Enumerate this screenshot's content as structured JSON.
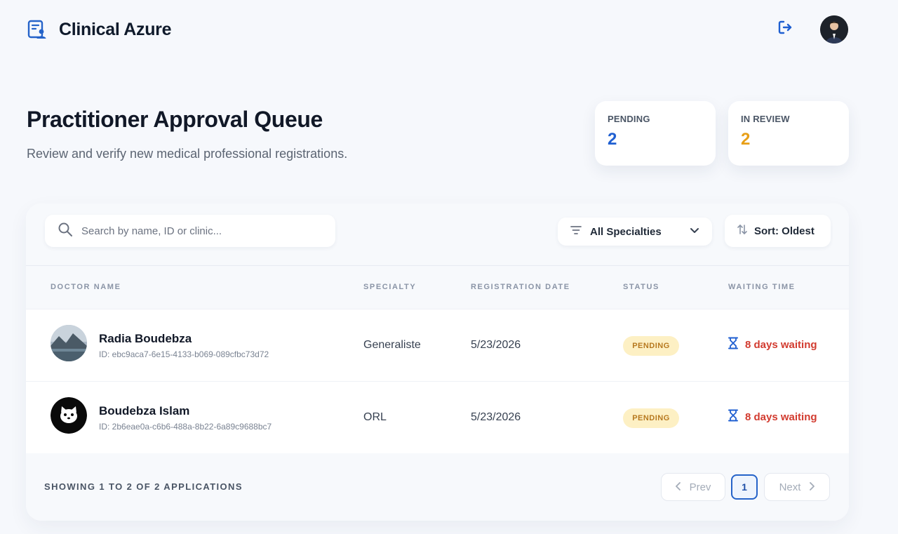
{
  "header": {
    "app_name": "Clinical Azure",
    "brand_icon": "clipboard-user-icon",
    "logout_icon": "logout-icon",
    "avatar": "user-avatar"
  },
  "page": {
    "title": "Practitioner Approval Queue",
    "subtitle": "Review and verify new medical professional registrations."
  },
  "stats": [
    {
      "label": "PENDING",
      "value": "2",
      "color": "#1f5fd1"
    },
    {
      "label": "IN REVIEW",
      "value": "2",
      "color": "#e89f17"
    }
  ],
  "toolbar": {
    "search_placeholder": "Search by name, ID or clinic...",
    "search_value": "",
    "filter_label": "All Specialties",
    "sort_label": "Sort: Oldest"
  },
  "table": {
    "columns": [
      "DOCTOR NAME",
      "SPECIALTY",
      "REGISTRATION DATE",
      "STATUS",
      "WAITING TIME"
    ],
    "rows": [
      {
        "name": "Radia Boudebza",
        "id": "ID: ebc9aca7-6e15-4133-b069-089cfbc73d72",
        "specialty": "Generaliste",
        "date": "5/23/2026",
        "status": "PENDING",
        "waiting": "8 days waiting",
        "avatar": "landscape-avatar"
      },
      {
        "name": "Boudebza Islam",
        "id": "ID: 2b6eae0a-c6b6-488a-8b22-6a89c9688bc7",
        "specialty": "ORL",
        "date": "5/23/2026",
        "status": "PENDING",
        "waiting": "8 days waiting",
        "avatar": "cat-avatar"
      }
    ]
  },
  "footer": {
    "showing": "SHOWING 1 TO 2 OF 2 APPLICATIONS",
    "prev": "Prev",
    "current_page": "1",
    "next": "Next"
  },
  "colors": {
    "accent": "#1f5fd1",
    "warning": "#e89f17",
    "danger": "#d23b2f",
    "badge_bg": "#fdf0c4"
  }
}
